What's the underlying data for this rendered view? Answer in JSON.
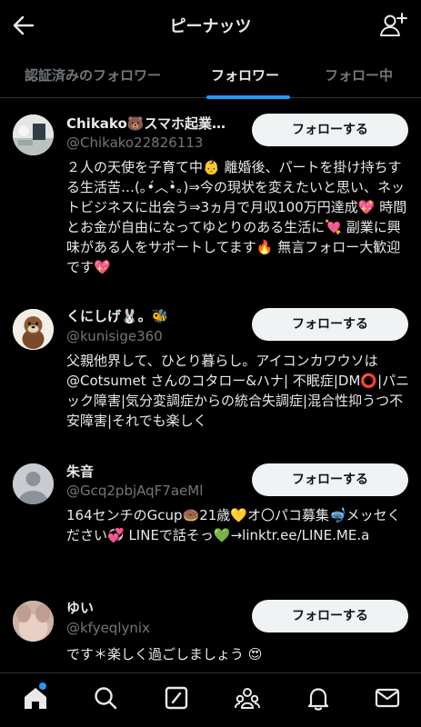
{
  "header": {
    "title": "ピーナッツ"
  },
  "tabs": [
    {
      "label": "認証済みのフォロワー"
    },
    {
      "label": "フォロワー"
    },
    {
      "label": "フォロー中"
    }
  ],
  "follow_label": "フォローする",
  "users": [
    {
      "name": "Chikako🐻スマホ起業…",
      "handle": "@Chikako22826113",
      "bio": "２人の天使を子育て中👶 離婚後、パートを掛け持ちする生活苦…(｡•́︿•̀｡)⇒今の現状を変えたいと思い、ネットビジネスに出会う⇒3ヵ月で月収100万円達成💖 時間とお金が自由になってゆとりのある生活に💘 副業に興味がある人をサポートしてます🔥 無言フォロー大歓迎です💖"
    },
    {
      "name": "くにしげ🐰。🐝",
      "handle": "@kunisige360",
      "bio": "父親他界して、ひとり暮らし。アイコンカワウソは@Cotsumet さんのコタロー&ハナ| 不眠症|DM⭕|パニック障害|気分変調症からの統合失調症|混合性抑うつ不安障害|それでも楽しく"
    },
    {
      "name": "朱音",
      "handle": "@Gcq2pbjAqF7aeMl",
      "bio": "164センチのGcup🍩21歳💛オ〇パコ募集🤿メッセください💞 LINEで話そっ💚→linktr.ee/LINE.ME.a"
    },
    {
      "name": "ゆい",
      "handle": "@kfyeqlynix",
      "bio": "です＊楽しく過ごしましょう 😍"
    }
  ],
  "icons": {
    "back": "arrow-left-icon",
    "add_user": "person-add-icon",
    "nav": [
      "home-icon",
      "search-icon",
      "compose-icon",
      "communities-icon",
      "notifications-icon",
      "messages-icon"
    ]
  },
  "colors": {
    "accent": "#1d9bf0",
    "button_bg": "#eff3f4",
    "muted": "#71767b"
  }
}
